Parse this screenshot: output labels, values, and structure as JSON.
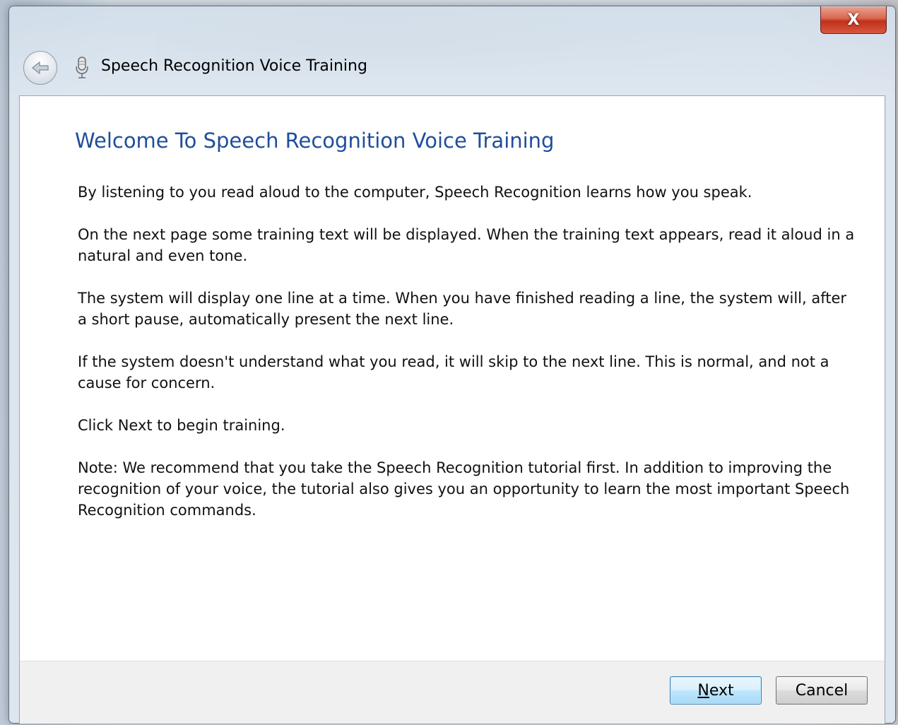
{
  "window": {
    "title": "Speech Recognition Voice Training",
    "close_label": "X"
  },
  "content": {
    "heading": "Welcome To Speech Recognition Voice Training",
    "paragraphs": [
      "By listening to you read aloud to the computer, Speech Recognition learns how you speak.",
      "On the next page some training text will be displayed. When the training text appears, read it aloud in a natural and even tone.",
      "The system will display one line at a time. When you have finished reading a line, the system will, after a short pause, automatically present the next line.",
      "If the system doesn't understand what you read, it will skip to the next line. This is normal, and not a cause for concern.",
      "Click Next to begin training.",
      "Note: We recommend that you take the Speech Recognition tutorial first. In addition to improving the recognition of your voice, the tutorial also gives you an opportunity to learn the most important Speech Recognition commands."
    ]
  },
  "buttons": {
    "next_accel": "N",
    "next_rest": "ext",
    "cancel_label": "Cancel"
  },
  "icons": {
    "back": "back-arrow-icon",
    "mic": "microphone-icon",
    "close": "close-icon"
  },
  "colors": {
    "heading": "#1f4e9a",
    "close_button": "#c1301b",
    "default_button_border": "#3c7fb1"
  }
}
